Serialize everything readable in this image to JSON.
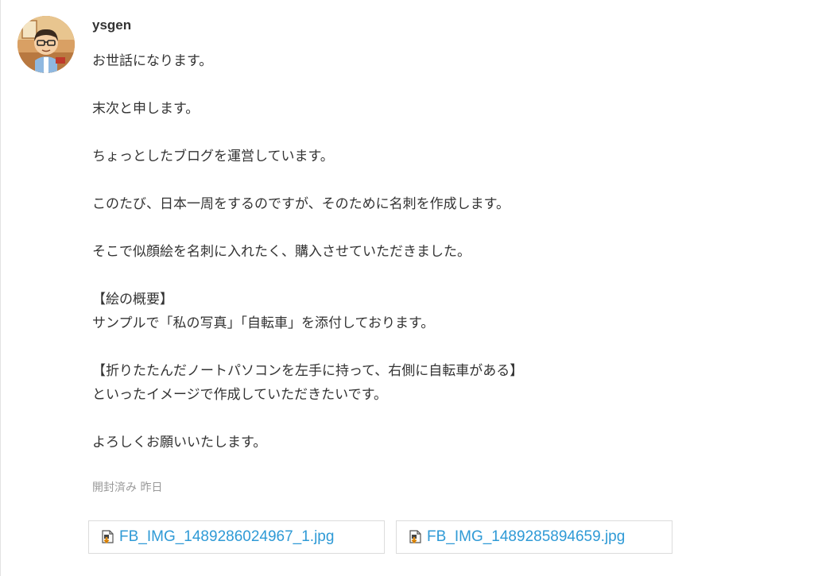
{
  "message": {
    "sender": "ysgen",
    "avatar_icon": "avatar-cartoon-icon",
    "lines": [
      "お世話になります。",
      "",
      "末次と申します。",
      "",
      "ちょっとしたブログを運営しています。",
      "",
      "このたび、日本一周をするのですが、そのために名刺を作成します。",
      "",
      "そこで似顔絵を名刺に入れたく、購入させていただきました。",
      "",
      "【絵の概要】",
      "サンプルで「私の写真」「自転車」を添付しております。",
      "",
      "【折りたたんだノートパソコンを左手に持って、右側に自転車がある】",
      "といったイメージで作成していただきたいです。",
      "",
      "よろしくお願いいたします。"
    ],
    "status": "開封済み 昨日",
    "attachments": [
      {
        "name": "FB_IMG_1489286024967_1.jpg",
        "icon": "download-file-icon"
      },
      {
        "name": "FB_IMG_1489285894659.jpg",
        "icon": "download-file-icon"
      }
    ]
  },
  "colors": {
    "text": "#333333",
    "status": "#9a9a9a",
    "link": "#2f9ad6",
    "border": "#dcdcdc"
  }
}
